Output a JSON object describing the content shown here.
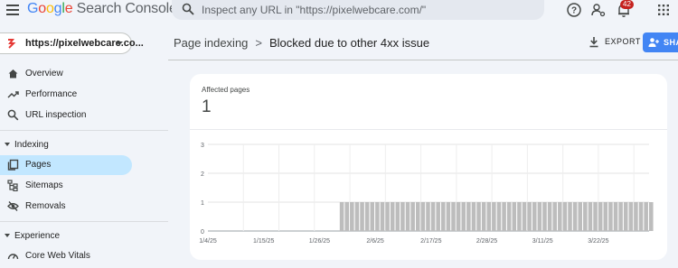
{
  "app": {
    "logo_google": "Google",
    "logo_product": "Search Console"
  },
  "search": {
    "placeholder": "Inspect any URL in \"https://pixelwebcare.com/\""
  },
  "topbar": {
    "notifications_count": "42"
  },
  "property": {
    "label": "https://pixelwebcare.co..."
  },
  "sidebar": {
    "items": [
      {
        "label": "Overview"
      },
      {
        "label": "Performance"
      },
      {
        "label": "URL inspection"
      }
    ],
    "sections": [
      {
        "label": "Indexing",
        "items": [
          {
            "label": "Pages"
          },
          {
            "label": "Sitemaps"
          },
          {
            "label": "Removals"
          }
        ]
      },
      {
        "label": "Experience",
        "items": [
          {
            "label": "Core Web Vitals"
          }
        ]
      }
    ]
  },
  "header": {
    "crumb_parent": "Page indexing",
    "separator": ">",
    "crumb_current": "Blocked due to other 4xx issue",
    "export_label": "EXPORT",
    "share_label": "SHA"
  },
  "metric": {
    "label": "Affected pages",
    "value": "1"
  },
  "colors": {
    "accent": "#4285f4",
    "active_nav": "#c2e7ff",
    "bar": "#bdbdbd"
  },
  "chart_data": {
    "type": "bar",
    "y_ticks": [
      "0",
      "1",
      "2",
      "3"
    ],
    "ylim": [
      0,
      3
    ],
    "x_tick_labels": [
      "1/4/25",
      "1/15/25",
      "1/26/25",
      "2/6/25",
      "2/17/25",
      "2/28/25",
      "3/11/25",
      "3/22/25"
    ],
    "x_range": [
      "1/4/25",
      "4/1/25"
    ],
    "bars_from": "1/30/25",
    "bars_to": "4/1/25",
    "bar_value": 1,
    "grid": true
  }
}
